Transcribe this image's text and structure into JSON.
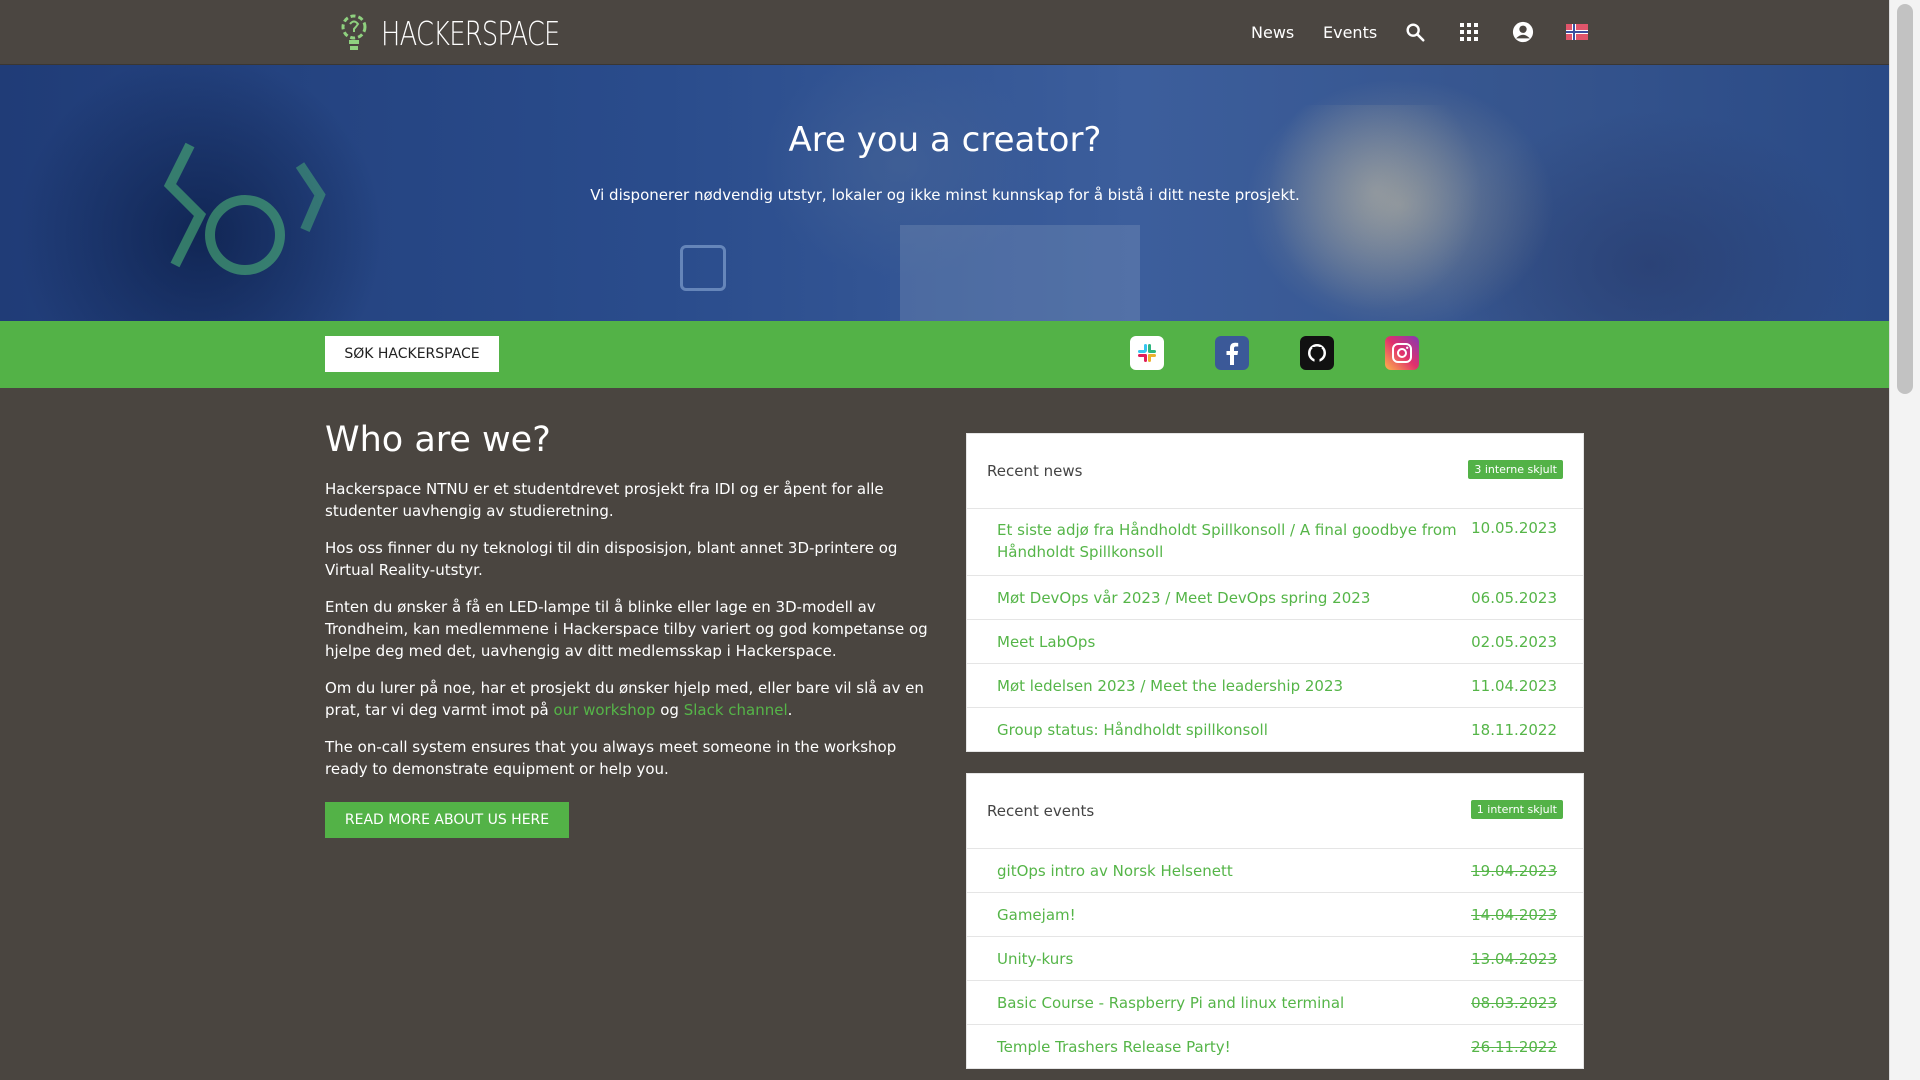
{
  "header": {
    "logo_text": "HACKERSPACE",
    "nav": [
      "News",
      "Events"
    ],
    "icons": [
      "search-icon",
      "apps-grid-icon",
      "account-icon",
      "norwegian-flag-icon"
    ]
  },
  "hero": {
    "title": "Are you a creator?",
    "subtitle": "Vi disponerer nødvendig utstyr, lokaler og ikke minst kunnskap for å bistå i ditt neste prosjekt."
  },
  "greenbar": {
    "search_button": "SØK HACKERSPACE",
    "socials": [
      "slack-icon",
      "facebook-icon",
      "github-icon",
      "instagram-icon"
    ]
  },
  "about": {
    "title": "Who are we?",
    "p1": "Hackerspace NTNU er et studentdrevet prosjekt fra IDI og er åpent for alle studenter uavhengig av studieretning.",
    "p2": "Hos oss finner du ny teknologi til din disposisjon, blant annet 3D-printere og Virtual Reality-utstyr.",
    "p3": "Enten du ønsker å få en LED-lampe til å blinke eller lage en 3D-modell av Trondheim, kan medlemmene i Hackerspace tilby variert og god kompetanse og hjelpe deg med det, uavhengig av ditt medlemsskap i Hackerspace.",
    "p4_before": "Om du lurer på noe, har et prosjekt du ønsker hjelp med, eller bare vil slå av en prat, tar vi deg varmt imot på ",
    "p4_link1": "our workshop",
    "p4_mid": " og ",
    "p4_link2": "Slack channel",
    "p4_after": ".",
    "p5": "The on-call system ensures that you always meet someone in the workshop ready to demonstrate equipment or help you.",
    "read_more": "READ MORE ABOUT US HERE"
  },
  "news": {
    "title": "Recent news",
    "badge": "3 interne skjult",
    "items": [
      {
        "title": "Et siste adjø fra Håndholdt Spillkonsoll / A final goodbye from Håndholdt Spillkonsoll",
        "date": "10.05.2023"
      },
      {
        "title": "Møt DevOps vår 2023 / Meet DevOps spring 2023",
        "date": "06.05.2023"
      },
      {
        "title": "Meet LabOps",
        "date": "02.05.2023"
      },
      {
        "title": "Møt ledelsen 2023 / Meet the leadership 2023",
        "date": "11.04.2023"
      },
      {
        "title": "Group status: Håndholdt spillkonsoll",
        "date": "18.11.2022"
      }
    ]
  },
  "events": {
    "title": "Recent events",
    "badge": "1 internt skjult",
    "items": [
      {
        "title": "gitOps intro av Norsk Helsenett",
        "date": "19.04.2023"
      },
      {
        "title": "Gamejam!",
        "date": "14.04.2023"
      },
      {
        "title": "Unity-kurs",
        "date": "13.04.2023"
      },
      {
        "title": "Basic Course - Raspberry Pi and linux terminal",
        "date": "08.03.2023"
      },
      {
        "title": "Temple Trashers Release Party!",
        "date": "26.11.2022"
      }
    ]
  }
}
